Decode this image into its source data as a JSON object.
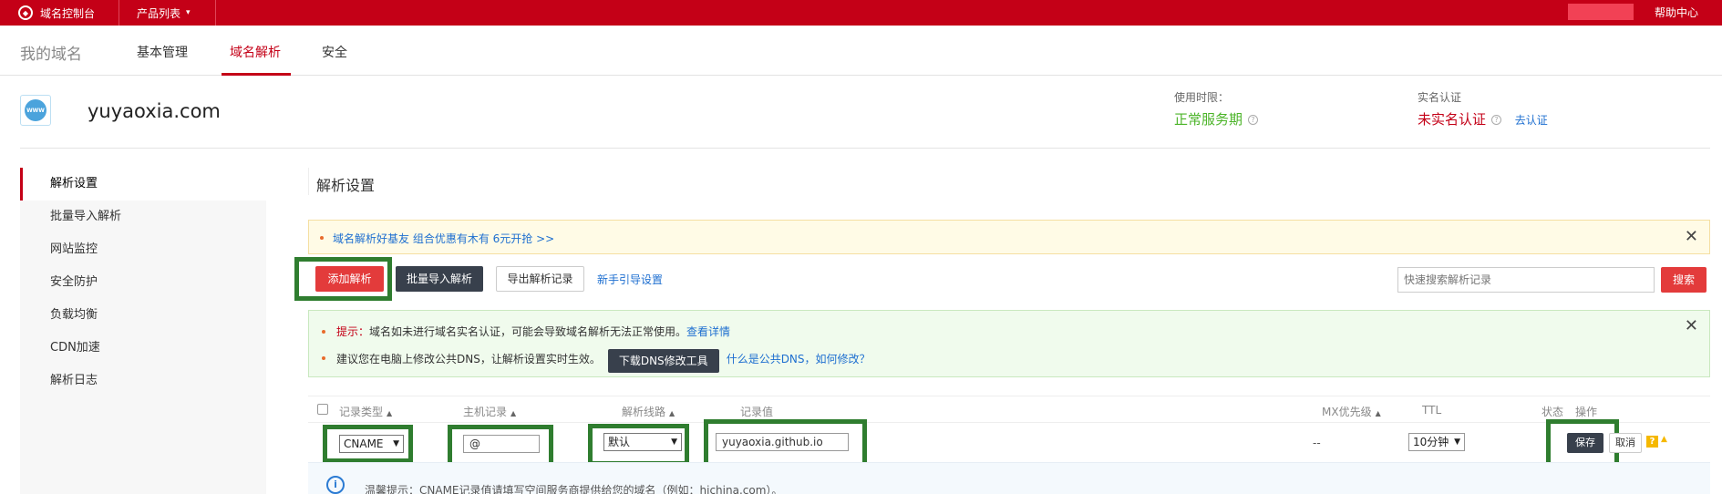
{
  "topbar": {
    "brand": "域名控制台",
    "products": "产品列表",
    "help": "帮助中心"
  },
  "nav": {
    "title": "我的域名",
    "tabs": [
      "基本管理",
      "域名解析",
      "安全"
    ]
  },
  "domain": {
    "name": "yuyaoxia.com",
    "icon_text": "WWW",
    "period_label": "使用时限：",
    "period_value": "正常服务期",
    "auth_label": "实名认证",
    "auth_value": "未实名认证",
    "auth_link": "去认证"
  },
  "sidebar": {
    "items": [
      "解析设置",
      "批量导入解析",
      "网站监控",
      "安全防护",
      "负载均衡",
      "CDN加速",
      "解析日志"
    ]
  },
  "main": {
    "title": "解析设置",
    "promo": "域名解析好基友 组合优惠有木有 6元开抢 >>",
    "buttons": {
      "add": "添加解析",
      "batch_import": "批量导入解析",
      "export": "导出解析记录",
      "guide": "新手引导设置",
      "search": "搜索"
    },
    "search_placeholder": "快速搜索解析记录",
    "notice": {
      "tip_label": "提示：",
      "tip_text": "域名如未进行域名实名认证，可能会导致域名解析无法正常使用。",
      "tip_link": "查看详情",
      "dns_text": "建议您在电脑上修改公共DNS，让解析设置实时生效。",
      "dns_button": "下载DNS修改工具",
      "dns_link": "什么是公共DNS，如何修改？"
    }
  },
  "table": {
    "headers": [
      "记录类型",
      "主机记录",
      "解析线路",
      "记录值",
      "MX优先级",
      "TTL",
      "状态",
      "操作"
    ],
    "row": {
      "type": "CNAME",
      "host": "@",
      "line": "默认",
      "value": "yuyaoxia.github.io",
      "mx": "--",
      "ttl": "10分钟",
      "save": "保存",
      "cancel": "取消",
      "help_mark": "?"
    },
    "tip": "温馨提示：CNAME记录值请填写空间服务商提供给您的域名（例如：hichina.com）。"
  },
  "colors": {
    "brand_red": "#c40017",
    "success_green": "#4bb428",
    "annotation_green": "#2f7d2f",
    "link_blue": "#1e6fd0"
  }
}
